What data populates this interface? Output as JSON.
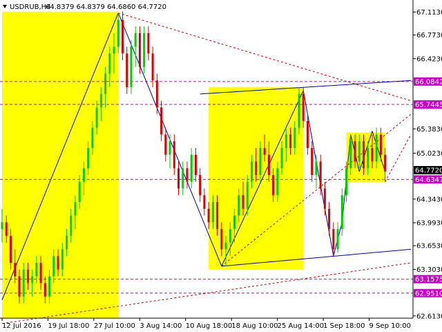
{
  "header": {
    "symbol": "USDRUB,H4",
    "ohlc": "64.8379 64.8379 64.6860 64.7720"
  },
  "chart_data": {
    "type": "candlestick",
    "symbol": "USDRUB",
    "timeframe": "H4",
    "ylim": [
      62.58,
      67.23
    ],
    "x_ticks": [
      "12 Jul 2016",
      "19 Jul 18:00",
      "27 Jul 10:00",
      "3 Aug 14:00",
      "10 Aug 18:00",
      "18 Aug 10:00",
      "25 Aug 14:00",
      "1 Sep 18:00",
      "9 Sep 10:00"
    ],
    "y_ticks": [
      "67.1130",
      "66.7730",
      "66.4230",
      "65.3830",
      "65.0230",
      "64.3430",
      "63.9930",
      "63.6530",
      "63.3030",
      "62.6130"
    ],
    "levels": [
      {
        "value": 66.0842,
        "label": "66.0842",
        "color": "#cc00cc"
      },
      {
        "value": 65.7445,
        "label": "65.7445",
        "color": "#cc00cc"
      },
      {
        "value": 64.6347,
        "label": "64.6347",
        "color": "#cc00cc"
      },
      {
        "value": 63.1575,
        "label": "63.1575",
        "color": "#cc00cc"
      },
      {
        "value": 62.951,
        "label": "62.9510",
        "color": "#cc00cc"
      }
    ],
    "current_price": {
      "value": 64.772,
      "label": "64.7720"
    },
    "colors": {
      "bull": "#00cc00",
      "bear": "#dd0000",
      "zone": "#ffff00",
      "trend_line": "#0000aa",
      "forecast_line": "#cc0000",
      "level_line": "#cc00cc",
      "current_price_bg": "#000000",
      "grid": "none"
    },
    "candles": [
      [
        63.9,
        64.2,
        63.7,
        64.0
      ],
      [
        64.0,
        64.1,
        63.7,
        63.8
      ],
      [
        63.8,
        63.9,
        63.3,
        63.4
      ],
      [
        63.4,
        63.6,
        63.1,
        63.2
      ],
      [
        63.2,
        63.3,
        62.8,
        62.9
      ],
      [
        62.9,
        63.4,
        62.8,
        63.3
      ],
      [
        63.3,
        63.4,
        63.0,
        63.1
      ],
      [
        63.1,
        63.3,
        62.9,
        63.2
      ],
      [
        63.2,
        63.5,
        63.1,
        63.4
      ],
      [
        63.4,
        63.5,
        63.0,
        63.1
      ],
      [
        63.1,
        63.2,
        62.8,
        62.9
      ],
      [
        62.9,
        63.3,
        62.8,
        63.2
      ],
      [
        63.2,
        63.6,
        63.1,
        63.5
      ],
      [
        63.5,
        63.6,
        63.2,
        63.3
      ],
      [
        63.3,
        63.7,
        63.2,
        63.6
      ],
      [
        63.6,
        63.9,
        63.5,
        63.8
      ],
      [
        63.8,
        64.2,
        63.7,
        64.1
      ],
      [
        64.1,
        64.4,
        63.9,
        64.3
      ],
      [
        64.3,
        64.7,
        64.2,
        64.6
      ],
      [
        64.6,
        64.9,
        64.4,
        64.8
      ],
      [
        64.8,
        65.2,
        64.7,
        65.1
      ],
      [
        65.1,
        65.5,
        65.0,
        65.4
      ],
      [
        65.4,
        65.8,
        65.3,
        65.7
      ],
      [
        65.7,
        66.0,
        65.5,
        65.9
      ],
      [
        65.9,
        66.3,
        65.7,
        66.2
      ],
      [
        66.2,
        66.6,
        66.0,
        66.5
      ],
      [
        66.5,
        66.8,
        66.2,
        66.6
      ],
      [
        66.6,
        67.1,
        66.5,
        67.0
      ],
      [
        67.0,
        67.12,
        66.4,
        66.5
      ],
      [
        66.5,
        66.6,
        65.9,
        66.0
      ],
      [
        66.0,
        66.7,
        65.9,
        66.6
      ],
      [
        66.6,
        66.9,
        66.3,
        66.8
      ],
      [
        66.8,
        66.9,
        66.2,
        66.3
      ],
      [
        66.3,
        66.9,
        66.2,
        66.8
      ],
      [
        66.8,
        66.9,
        66.4,
        66.5
      ],
      [
        66.5,
        66.6,
        66.0,
        66.1
      ],
      [
        66.1,
        66.2,
        65.6,
        65.7
      ],
      [
        65.7,
        65.8,
        65.2,
        65.3
      ],
      [
        65.3,
        65.4,
        64.9,
        65.0
      ],
      [
        65.0,
        65.3,
        64.8,
        65.2
      ],
      [
        65.2,
        65.3,
        64.7,
        64.8
      ],
      [
        64.8,
        64.9,
        64.4,
        64.5
      ],
      [
        64.5,
        64.9,
        64.4,
        64.8
      ],
      [
        64.8,
        64.9,
        64.5,
        64.6
      ],
      [
        64.6,
        65.1,
        64.5,
        65.0
      ],
      [
        65.0,
        65.1,
        64.6,
        64.7
      ],
      [
        64.7,
        64.8,
        64.3,
        64.4
      ],
      [
        64.4,
        64.5,
        64.1,
        64.2
      ],
      [
        64.2,
        64.3,
        63.9,
        64.0
      ],
      [
        64.0,
        64.4,
        63.9,
        64.3
      ],
      [
        64.3,
        64.4,
        63.8,
        63.9
      ],
      [
        63.9,
        64.0,
        63.5,
        63.6
      ],
      [
        63.6,
        63.8,
        63.35,
        63.7
      ],
      [
        63.7,
        64.0,
        63.5,
        63.9
      ],
      [
        63.9,
        64.2,
        63.7,
        64.1
      ],
      [
        64.1,
        64.5,
        64.0,
        64.4
      ],
      [
        64.4,
        64.6,
        64.1,
        64.2
      ],
      [
        64.2,
        64.7,
        64.1,
        64.6
      ],
      [
        64.6,
        65.0,
        64.5,
        64.9
      ],
      [
        64.9,
        65.1,
        64.6,
        64.7
      ],
      [
        64.7,
        65.2,
        64.6,
        65.1
      ],
      [
        65.1,
        65.3,
        64.9,
        65.0
      ],
      [
        65.0,
        65.2,
        64.6,
        64.7
      ],
      [
        64.7,
        64.8,
        64.3,
        64.4
      ],
      [
        64.4,
        64.9,
        64.3,
        64.8
      ],
      [
        64.8,
        65.2,
        64.7,
        65.1
      ],
      [
        65.1,
        65.4,
        64.9,
        65.3
      ],
      [
        65.3,
        65.4,
        65.0,
        65.1
      ],
      [
        65.1,
        65.5,
        65.0,
        65.4
      ],
      [
        65.4,
        66.0,
        65.3,
        65.9
      ],
      [
        65.9,
        66.0,
        65.4,
        65.5
      ],
      [
        65.5,
        65.6,
        65.0,
        65.1
      ],
      [
        65.1,
        65.2,
        64.6,
        64.7
      ],
      [
        64.7,
        65.0,
        64.5,
        64.9
      ],
      [
        64.9,
        65.0,
        64.4,
        64.5
      ],
      [
        64.5,
        64.6,
        64.1,
        64.2
      ],
      [
        64.2,
        64.3,
        63.8,
        63.9
      ],
      [
        63.9,
        64.0,
        63.5,
        63.6
      ],
      [
        63.6,
        64.0,
        63.55,
        63.9
      ],
      [
        63.9,
        64.5,
        63.8,
        64.4
      ],
      [
        64.4,
        64.9,
        64.3,
        64.8
      ],
      [
        64.8,
        65.3,
        64.7,
        65.2
      ],
      [
        65.2,
        65.3,
        64.8,
        64.9
      ],
      [
        64.9,
        65.3,
        64.8,
        65.2
      ],
      [
        65.2,
        65.3,
        64.7,
        64.8
      ],
      [
        64.8,
        65.2,
        64.7,
        65.1
      ],
      [
        65.1,
        65.3,
        64.8,
        64.9
      ],
      [
        64.9,
        65.4,
        64.8,
        65.3
      ],
      [
        65.3,
        65.4,
        64.9,
        65.0
      ],
      [
        65.0,
        65.1,
        64.6,
        64.75
      ]
    ],
    "zones": [
      {
        "from_bar": 0,
        "to_bar": 27,
        "top": 67.12,
        "bottom": 62.58
      },
      {
        "from_bar": 48,
        "to_bar": 70,
        "top": 66.0,
        "bottom": 63.3
      },
      {
        "from_bar": 80,
        "to_bar": 89,
        "top": 65.33,
        "bottom": 64.6
      }
    ],
    "trend_lines": [
      {
        "from": [
          0,
          62.85
        ],
        "to": [
          27,
          67.1
        ]
      },
      {
        "from": [
          27,
          67.1
        ],
        "to": [
          51,
          63.35
        ]
      },
      {
        "from": [
          51,
          63.35
        ],
        "to": [
          70,
          65.95
        ]
      },
      {
        "from": [
          70,
          65.95
        ],
        "to": [
          77,
          63.5
        ]
      },
      {
        "from": [
          77,
          63.5
        ],
        "to": [
          79,
          64.0
        ]
      },
      {
        "from": [
          79,
          64.0
        ],
        "to": [
          81,
          65.3
        ]
      },
      {
        "from": [
          81,
          65.3
        ],
        "to": [
          83,
          64.75
        ]
      },
      {
        "from": [
          83,
          64.75
        ],
        "to": [
          86,
          65.35
        ]
      },
      {
        "from": [
          86,
          65.35
        ],
        "to": [
          89,
          64.75
        ]
      },
      {
        "from": [
          46,
          65.9
        ],
        "to": [
          95,
          66.1
        ]
      },
      {
        "from": [
          51,
          63.35
        ],
        "to": [
          95,
          63.6
        ]
      }
    ],
    "forecast_lines": [
      {
        "from": [
          27,
          67.1
        ],
        "to": [
          95,
          65.8
        ]
      },
      {
        "from": [
          0,
          62.5
        ],
        "to": [
          95,
          63.4
        ]
      },
      {
        "from": [
          51,
          63.35
        ],
        "to": [
          95,
          65.6
        ]
      },
      {
        "from": [
          89,
          64.6
        ],
        "to": [
          95,
          65.3
        ]
      }
    ]
  }
}
